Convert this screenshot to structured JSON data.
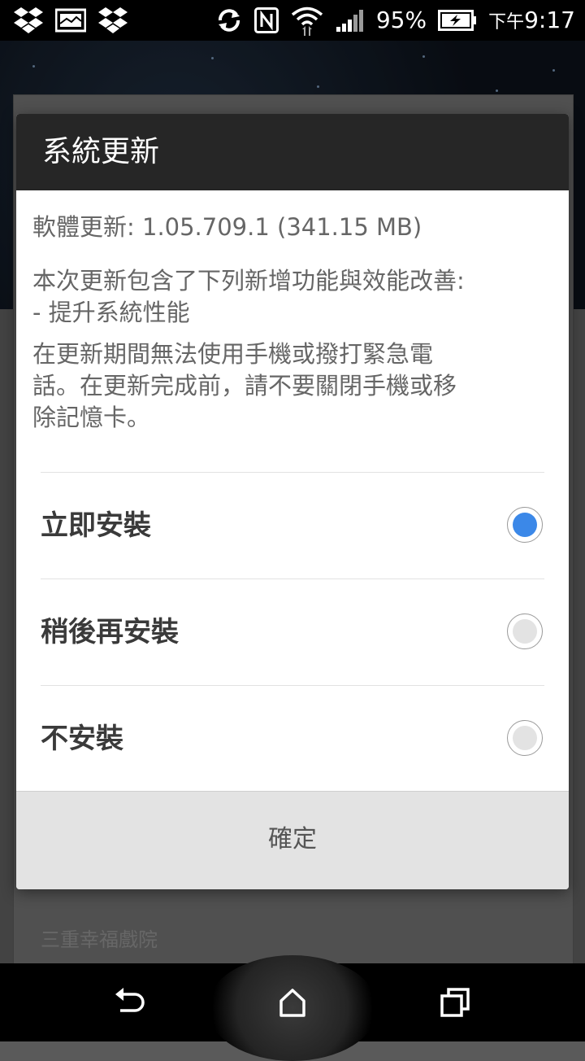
{
  "status_bar": {
    "left_icons": [
      "dropbox-icon",
      "image-icon",
      "dropbox-icon"
    ],
    "right_icons": [
      "sync-icon",
      "nfc-icon",
      "wifi-icon",
      "signal-icon",
      "battery-charging-icon"
    ],
    "battery_percent": "95%",
    "time_prefix": "下午",
    "time": "9:17"
  },
  "background": {
    "visible_text": "三重幸福戲院"
  },
  "dialog": {
    "title": "系統更新",
    "version_line": "軟體更新: 1.05.709.1 (341.15 MB)",
    "description_line1": "本次更新包含了下列新增功能與效能改善:",
    "description_line2": "- 提升系統性能",
    "warning_line1": "在更新期間無法使用手機或撥打緊急電",
    "warning_line2": "話。在更新完成前，請不要關閉手機或移",
    "warning_line3": "除記憶卡。",
    "options": [
      {
        "label": "立即安裝",
        "selected": true
      },
      {
        "label": "稍後再安裝",
        "selected": false
      },
      {
        "label": "不安裝",
        "selected": false
      }
    ],
    "confirm_button": "確定"
  },
  "nav_bar": {
    "buttons": [
      "back-icon",
      "home-icon",
      "recent-apps-icon"
    ]
  },
  "colors": {
    "accent": "#3b88e8",
    "dialog_title_bg": "#262626",
    "button_bar_bg": "#e3e3e3"
  }
}
